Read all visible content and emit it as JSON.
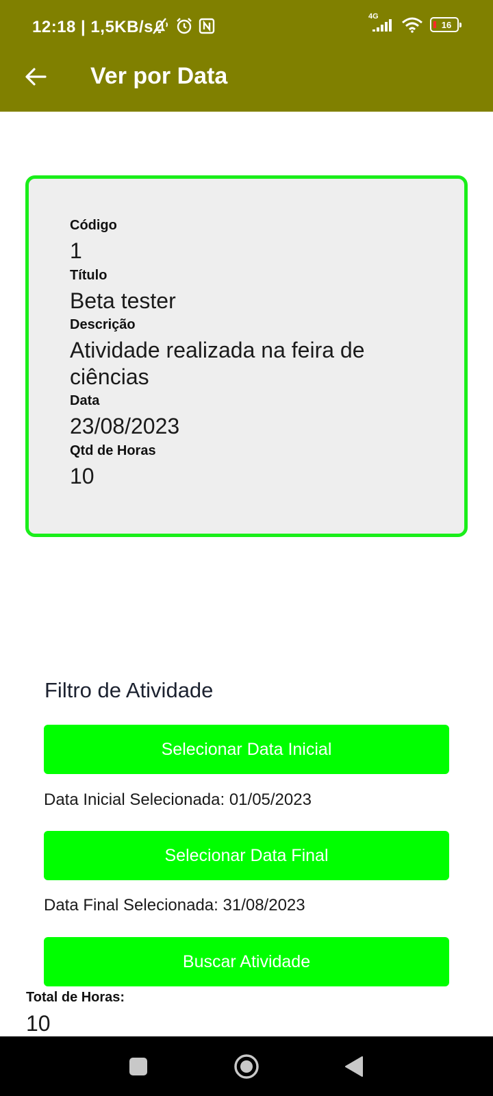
{
  "status_bar": {
    "time": "12:18 | 1,5KB/s",
    "network_label": "4G",
    "battery_level": "16"
  },
  "app_bar": {
    "title": "Ver por Data"
  },
  "card": {
    "codigo_label": "Código",
    "codigo_value": "1",
    "titulo_label": "Título",
    "titulo_value": "Beta tester",
    "descricao_label": "Descrição",
    "descricao_value": "Atividade realizada na feira de ciências",
    "data_label": "Data",
    "data_value": "23/08/2023",
    "horas_label": "Qtd de Horas",
    "horas_value": "10"
  },
  "filter": {
    "title": "Filtro de Atividade",
    "select_initial_label": "Selecionar Data Inicial",
    "initial_selected_text": "Data Inicial Selecionada: 01/05/2023",
    "select_final_label": "Selecionar Data Final",
    "final_selected_text": "Data Final Selecionada: 31/08/2023",
    "search_label": "Buscar Atividade"
  },
  "total": {
    "label": "Total de Horas:",
    "value": "10"
  },
  "colors": {
    "app_bar": "#808000",
    "card_border": "#1aee1a",
    "card_bg": "#eeeeee",
    "button": "#00ff00"
  }
}
